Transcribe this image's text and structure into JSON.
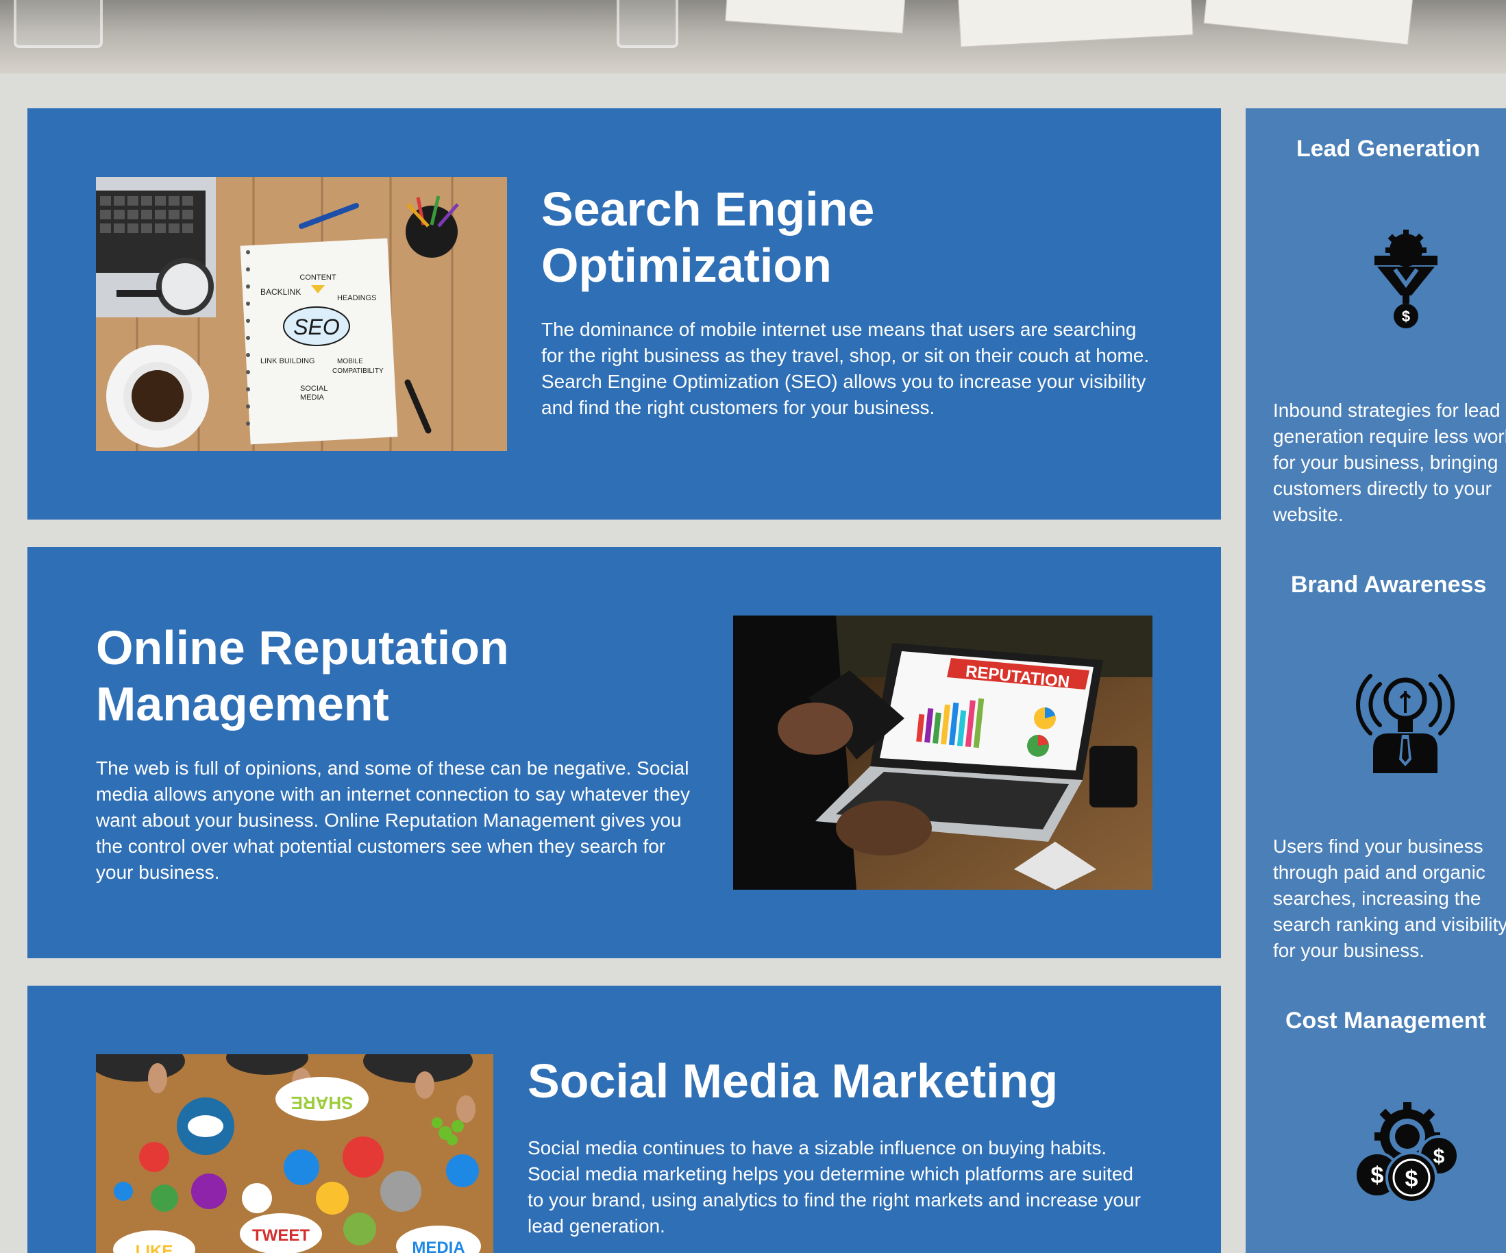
{
  "services": [
    {
      "title_line1": "Search Engine",
      "title_line2": "Optimization",
      "description": "The dominance of mobile internet use means that users are searching for the right business as they travel, shop, or sit on their couch at home. Search Engine Optimization (SEO) allows you to increase your visibility and find the right customers for your business.",
      "image_words": {
        "center": "SEO",
        "content": "CONTENT",
        "backlink": "BACKLINK",
        "headings": "HEADINGS",
        "link_building": "LINK BUILDING",
        "mobile": "MOBILE",
        "compatibility": "COMPATIBILITY",
        "social": "SOCIAL",
        "media": "MEDIA"
      }
    },
    {
      "title_line1": "Online Reputation",
      "title_line2": "Management",
      "description": "The web is full of opinions, and some of these can be negative. Social media allows anyone with an internet connection to say whatever they want about your business. Online Reputation Management gives you the control over what potential customers see when they search for your business.",
      "image_banner": "REPUTATION"
    },
    {
      "title_line1": "Social Media Marketing",
      "description": "Social media continues to have a sizable influence on buying habits. Social media marketing helps you determine which platforms are suited to your brand, using analytics to find the right markets and increase your lead generation.",
      "image_words": {
        "share": "SHARE",
        "tweet": "TWEET",
        "like": "LIKE",
        "media": "MEDIA"
      }
    }
  ],
  "sidebar": {
    "items": [
      {
        "title": "Lead Generation",
        "icon": "funnel-gear-dollar-icon",
        "description_lines": [
          "Inbound strategies for lead",
          "generation require less work",
          "for your business, bringing",
          "customers directly to your",
          "website."
        ]
      },
      {
        "title": "Brand Awareness",
        "icon": "lightbulb-person-broadcast-icon",
        "description_lines": [
          "Users find your business",
          "through paid and organic",
          "searches, increasing the",
          "search ranking and visibility",
          "for your business."
        ]
      },
      {
        "title": "Cost Management",
        "icon": "gear-coins-dollar-icon"
      }
    ]
  },
  "colors": {
    "card_blue": "#2f6fb5",
    "sidebar_blue": "#4a7fb8",
    "background": "#dcddd9"
  }
}
